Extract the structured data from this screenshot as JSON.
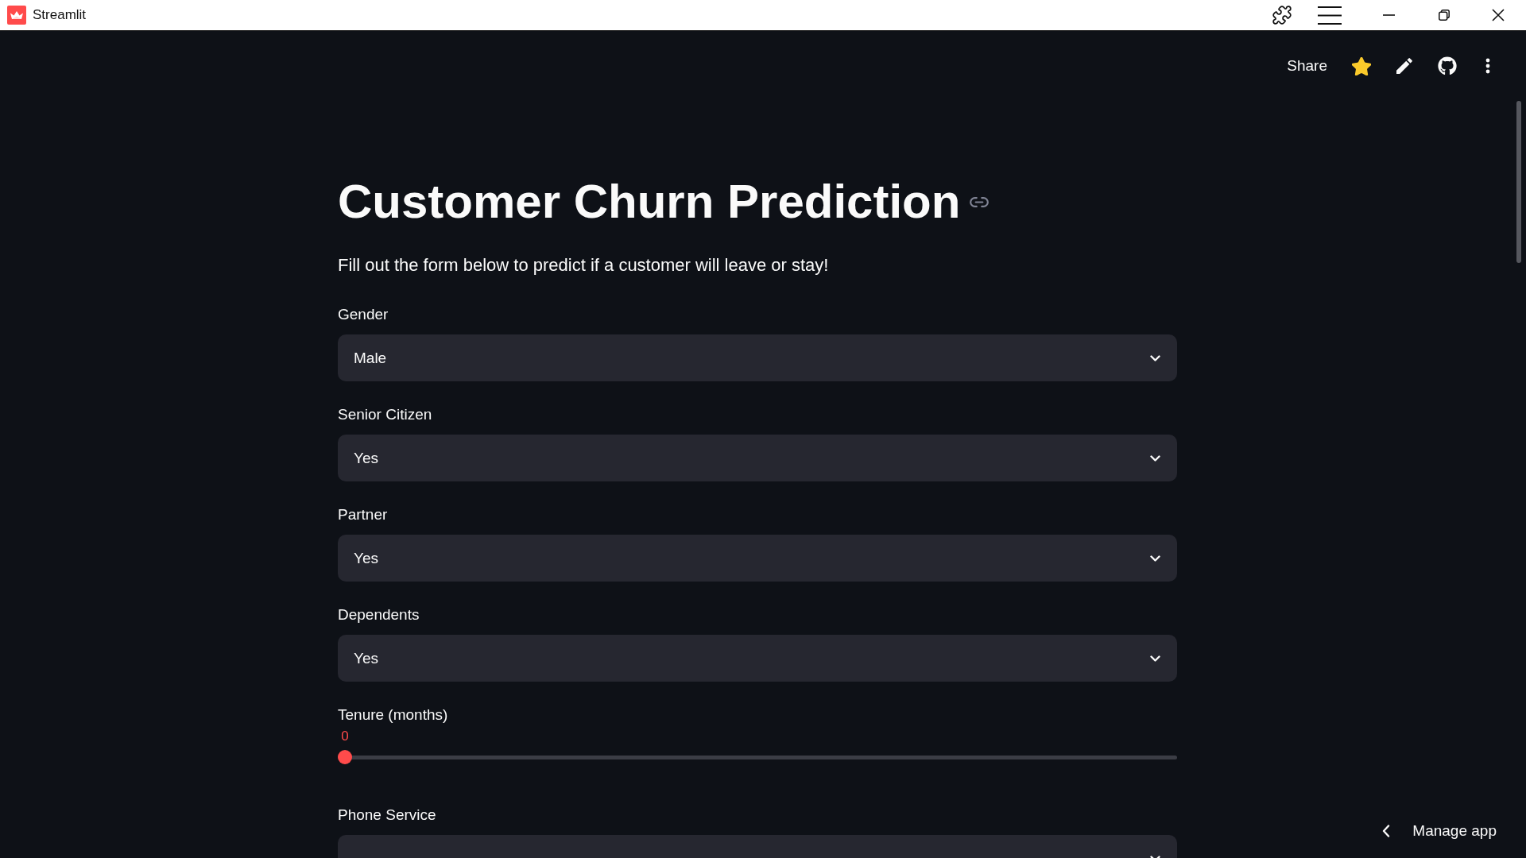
{
  "window": {
    "title": "Streamlit"
  },
  "toolbar": {
    "share": "Share",
    "favorite": true
  },
  "page": {
    "title": "Customer Churn Prediction",
    "subtitle": "Fill out the form below to predict if a customer will leave or stay!"
  },
  "fields": [
    {
      "kind": "select",
      "label": "Gender",
      "value": "Male"
    },
    {
      "kind": "select",
      "label": "Senior Citizen",
      "value": "Yes"
    },
    {
      "kind": "select",
      "label": "Partner",
      "value": "Yes"
    },
    {
      "kind": "select",
      "label": "Dependents",
      "value": "Yes"
    },
    {
      "kind": "slider",
      "label": "Tenure (months)",
      "reading": "0",
      "level": 0
    },
    {
      "kind": "select",
      "label": "Phone Service"
    }
  ],
  "manage_app": {
    "label": "Manage app"
  }
}
